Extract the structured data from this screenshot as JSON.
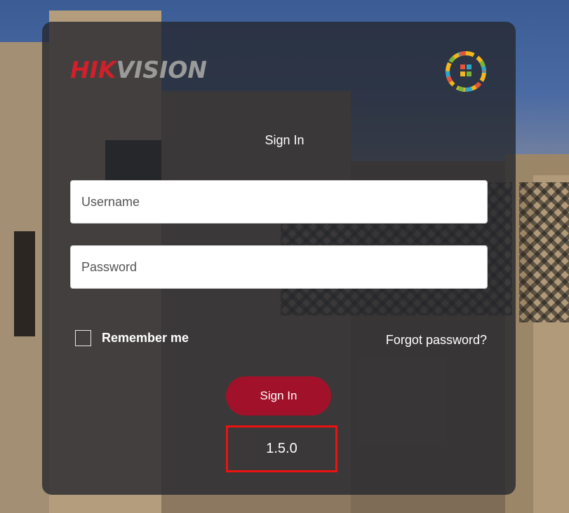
{
  "brand": {
    "logo_red": "HIK",
    "logo_gray": "VISION",
    "logo_red_color": "#d0202a",
    "logo_gray_color": "#9a9a9a",
    "badge_icon": "colorful-ring-emblem-icon"
  },
  "form": {
    "title": "Sign In",
    "username_placeholder": "Username",
    "username_value": "",
    "password_placeholder": "Password",
    "password_value": "",
    "remember_label": "Remember me",
    "remember_checked": false,
    "forgot_label": "Forgot password?",
    "submit_label": "Sign In",
    "submit_color": "#a1122a"
  },
  "footer": {
    "version": "1.5.0",
    "highlight_color": "#ee1111"
  }
}
